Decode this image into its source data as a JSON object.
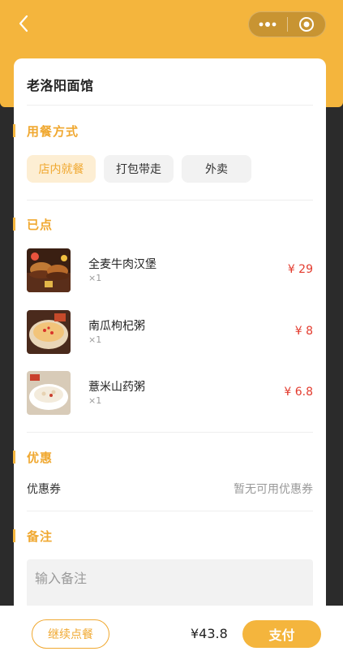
{
  "nav": {
    "back_icon": "chevron-left-icon",
    "more_icon": "more-dots-icon",
    "close_icon": "target-circle-icon"
  },
  "shop": {
    "name": "老洛阳面馆"
  },
  "dining": {
    "title": "用餐方式",
    "options": [
      "店内就餐",
      "打包带走",
      "外卖"
    ],
    "selected": "店内就餐"
  },
  "ordered": {
    "title": "已点",
    "items": [
      {
        "name": "全麦牛肉汉堡",
        "qty": "×1",
        "price": "¥ 29"
      },
      {
        "name": "南瓜枸杞粥",
        "qty": "×1",
        "price": "¥ 8"
      },
      {
        "name": "薏米山药粥",
        "qty": "×1",
        "price": "¥ 6.8"
      }
    ]
  },
  "discount": {
    "title": "优惠",
    "coupon_label": "优惠券",
    "coupon_value": "暂无可用优惠券"
  },
  "remark": {
    "title": "备注",
    "placeholder": "输入备注"
  },
  "footer": {
    "continue_label": "继续点餐",
    "total": "¥43.8",
    "pay_label": "支付"
  },
  "colors": {
    "accent": "#f4b53d",
    "accent_text": "#f0a830",
    "price": "#e33b2e"
  }
}
